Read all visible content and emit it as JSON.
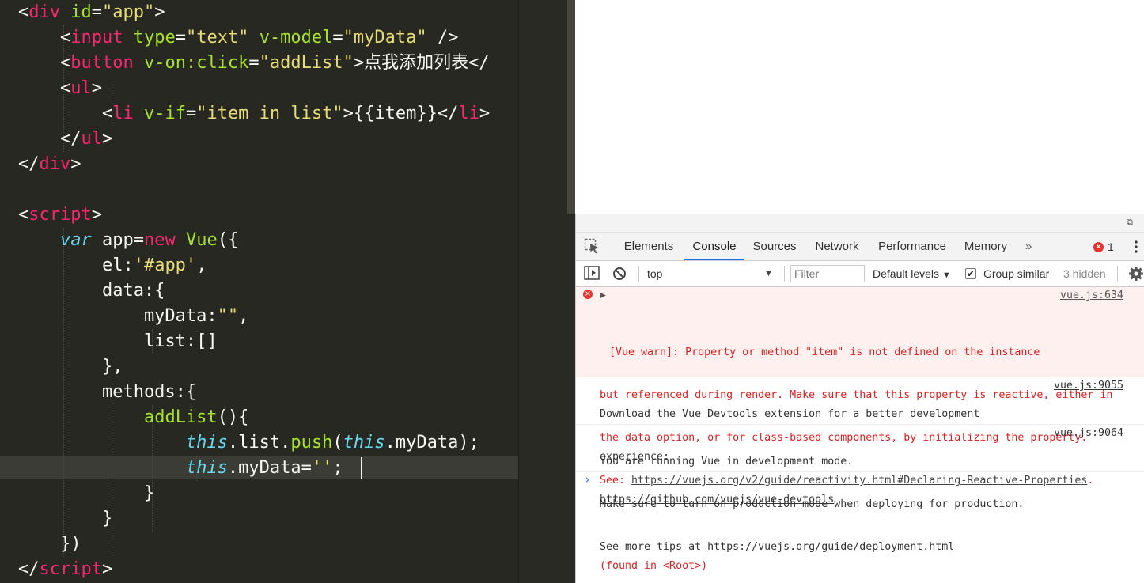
{
  "editor": {
    "colors": {
      "bg": "#272822",
      "default": "#f8f8f2",
      "tag": "#f92672",
      "attr": "#a6e22e",
      "string": "#e6db74",
      "keyword": "#f92672",
      "storage": "#66d9ef",
      "func": "#a6e22e"
    },
    "lines": [
      [
        {
          "t": "<",
          "c": "default"
        },
        {
          "t": "div",
          "c": "tag"
        },
        {
          "t": " ",
          "c": "default"
        },
        {
          "t": "id",
          "c": "attr"
        },
        {
          "t": "=",
          "c": "default"
        },
        {
          "t": "\"app\"",
          "c": "string"
        },
        {
          "t": ">",
          "c": "default"
        }
      ],
      [
        {
          "t": "    <",
          "c": "default"
        },
        {
          "t": "input",
          "c": "tag"
        },
        {
          "t": " ",
          "c": "default"
        },
        {
          "t": "type",
          "c": "attr"
        },
        {
          "t": "=",
          "c": "default"
        },
        {
          "t": "\"text\"",
          "c": "string"
        },
        {
          "t": " ",
          "c": "default"
        },
        {
          "t": "v-model",
          "c": "attr"
        },
        {
          "t": "=",
          "c": "default"
        },
        {
          "t": "\"myData\"",
          "c": "string"
        },
        {
          "t": " />",
          "c": "default"
        }
      ],
      [
        {
          "t": "    <",
          "c": "default"
        },
        {
          "t": "button",
          "c": "tag"
        },
        {
          "t": " ",
          "c": "default"
        },
        {
          "t": "v-on:click",
          "c": "attr"
        },
        {
          "t": "=",
          "c": "default"
        },
        {
          "t": "\"addList\"",
          "c": "string"
        },
        {
          "t": ">点我添加列表</",
          "c": "default"
        }
      ],
      [
        {
          "t": "    <",
          "c": "default"
        },
        {
          "t": "ul",
          "c": "tag"
        },
        {
          "t": ">",
          "c": "default"
        }
      ],
      [
        {
          "t": "        <",
          "c": "default"
        },
        {
          "t": "li",
          "c": "tag"
        },
        {
          "t": " ",
          "c": "default"
        },
        {
          "t": "v-if",
          "c": "attr"
        },
        {
          "t": "=",
          "c": "default"
        },
        {
          "t": "\"item in list\"",
          "c": "string"
        },
        {
          "t": ">{{item}}</",
          "c": "default"
        },
        {
          "t": "li",
          "c": "tag"
        },
        {
          "t": ">",
          "c": "default"
        }
      ],
      [
        {
          "t": "    </",
          "c": "default"
        },
        {
          "t": "ul",
          "c": "tag"
        },
        {
          "t": ">",
          "c": "default"
        }
      ],
      [
        {
          "t": "</",
          "c": "default"
        },
        {
          "t": "div",
          "c": "tag"
        },
        {
          "t": ">",
          "c": "default"
        }
      ],
      [],
      [
        {
          "t": "<",
          "c": "default"
        },
        {
          "t": "script",
          "c": "tag"
        },
        {
          "t": ">",
          "c": "default"
        }
      ],
      [
        {
          "t": "    ",
          "c": "default"
        },
        {
          "t": "var",
          "c": "storage",
          "i": true
        },
        {
          "t": " app=",
          "c": "default"
        },
        {
          "t": "new",
          "c": "keyword"
        },
        {
          "t": " ",
          "c": "default"
        },
        {
          "t": "Vue",
          "c": "func"
        },
        {
          "t": "({",
          "c": "default"
        }
      ],
      [
        {
          "t": "        el:",
          "c": "default"
        },
        {
          "t": "'#app'",
          "c": "string"
        },
        {
          "t": ",",
          "c": "default"
        }
      ],
      [
        {
          "t": "        data:{",
          "c": "default"
        }
      ],
      [
        {
          "t": "            myData:",
          "c": "default"
        },
        {
          "t": "\"\"",
          "c": "string"
        },
        {
          "t": ",",
          "c": "default"
        }
      ],
      [
        {
          "t": "            list:[]",
          "c": "default"
        }
      ],
      [
        {
          "t": "        },",
          "c": "default"
        }
      ],
      [
        {
          "t": "        methods:{",
          "c": "default"
        }
      ],
      [
        {
          "t": "            ",
          "c": "default"
        },
        {
          "t": "addList",
          "c": "func"
        },
        {
          "t": "(){",
          "c": "default"
        }
      ],
      [
        {
          "t": "                ",
          "c": "default"
        },
        {
          "t": "this",
          "c": "storage",
          "i": true
        },
        {
          "t": ".list.",
          "c": "default"
        },
        {
          "t": "push",
          "c": "func"
        },
        {
          "t": "(",
          "c": "default"
        },
        {
          "t": "this",
          "c": "storage",
          "i": true
        },
        {
          "t": ".myData);",
          "c": "default"
        }
      ],
      [
        {
          "t": "                ",
          "c": "default"
        },
        {
          "t": "this",
          "c": "storage",
          "i": true
        },
        {
          "t": ".myData=",
          "c": "default"
        },
        {
          "t": "''",
          "c": "string"
        },
        {
          "t": ";",
          "c": "default"
        }
      ],
      [
        {
          "t": "            }",
          "c": "default"
        }
      ],
      [
        {
          "t": "        }",
          "c": "default"
        }
      ],
      [
        {
          "t": "    })",
          "c": "default"
        }
      ],
      [
        {
          "t": "</",
          "c": "default"
        },
        {
          "t": "script",
          "c": "tag"
        },
        {
          "t": ">",
          "c": "default"
        }
      ]
    ]
  },
  "devtools": {
    "tabs": [
      "Elements",
      "Console",
      "Sources",
      "Network",
      "Performance",
      "Memory"
    ],
    "active_tab": "Console",
    "more": "»",
    "error_count": "1",
    "toolbar": {
      "context": "top",
      "filter_placeholder": "Filter",
      "levels": "Default levels",
      "group_similar": "Group similar",
      "hidden": "3 hidden"
    },
    "messages": {
      "error": {
        "lines": [
          "[Vue warn]: Property or method \"item\" is not defined on the instance",
          "but referenced during render. Make sure that this property is reactive, either in",
          "the data option, or for class-based components, by initializing the property."
        ],
        "see_prefix": "See: ",
        "link": "https://vuejs.org/v2/guide/reactivity.html#Declaring-Reactive-Properties",
        "see_suffix": ".",
        "found": "(found in <Root>)",
        "source": "vue.js:634"
      },
      "devtools_hint": {
        "line1": "Download the Vue Devtools extension for a better development",
        "line2": "experience:",
        "link": "https://github.com/vuejs/vue-devtools",
        "source": "vue.js:9055"
      },
      "dev_mode": {
        "line1": "You are running Vue in development mode.",
        "line2": "Make sure to turn on production mode when deploying for production.",
        "line3_prefix": "See more tips at ",
        "link": "https://vuejs.org/guide/deployment.html",
        "source": "vue.js:9064"
      }
    },
    "prompt": "›"
  }
}
